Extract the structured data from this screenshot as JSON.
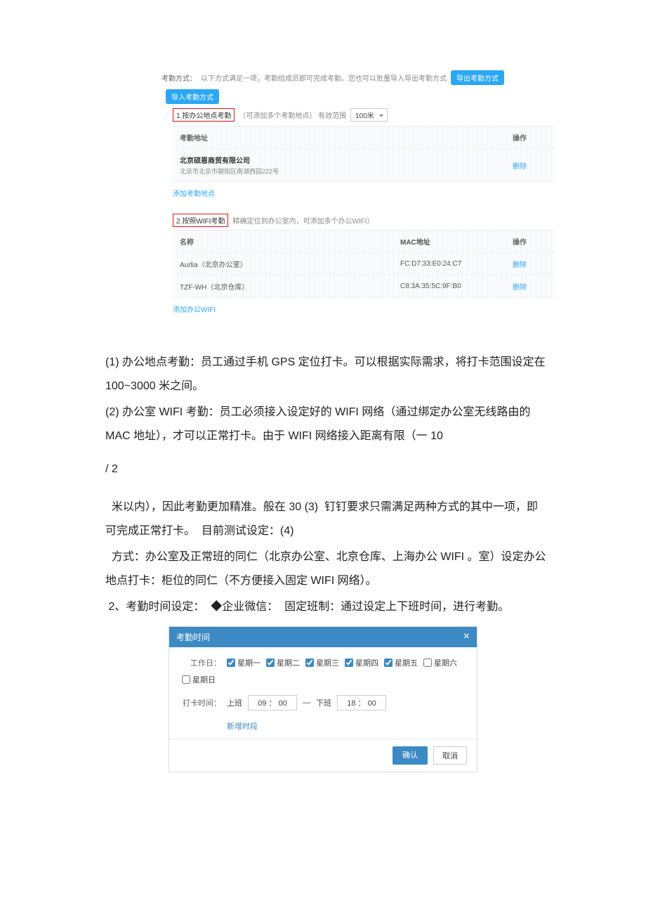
{
  "shot1": {
    "label": "考勤方式：",
    "desc": "以下方式满足一项，考勤组成员即可完成考勤。您也可以批量导入导出考勤方式",
    "btn_export": "导出考勤方式",
    "btn_import": "导入考勤方式",
    "sec1_title": "1.按办公地点考勤",
    "sec1_note": "（可添加多个考勤地点）  有效范围",
    "range_value": "100米",
    "head_addr": "考勤地址",
    "head_op": "操作",
    "company": "北京硕恩商贸有限公司",
    "company_sub": "北京市北京市朝阳区南湖西园222号",
    "row_action": "删除",
    "add_addr": "添加考勤地点",
    "sec2_title": "2.按照WIFI考勤",
    "sec2_note": "精确定位到办公室内，可添加多个办公WIFI）",
    "head_name": "名称",
    "head_mac": "MAC地址",
    "head_op2": "操作",
    "wifi1_name": "Aurlia（北京办公室）",
    "wifi1_mac": "FC:D7:33:E0:24:C7",
    "wifi2_name": "TZF-WH（北京仓库）",
    "wifi2_mac": "C8:3A:35:5C:9F:B0",
    "wifi_action": "删除",
    "add_wifi": "添加办公WIFI"
  },
  "doc": {
    "p1": "(1) 办公地点考勤：员工通过手机 GPS 定位打卡。可以根据实际需求，将打卡范围设定在 100~3000 米之间。",
    "p2": "(2) 办公室 WIFI 考勤：员工必须接入设定好的 WIFI 网络（通过绑定办公室无线路由的 MAC 地址），才可以正常打卡。由于 WIFI 网络接入距离有限（一 10",
    "slash": "/ 2",
    "p3": "  米以内），因此考勤更加精准。般在 30 (3)  钉钉要求只需满足两种方式的其中一项，即可完成正常打卡。  目前测试设定：(4)",
    "p4": "  方式：办公室及正常班的同仁（北京办公室、北京仓库、上海办公 WIFI 。室）设定办公地点打卡：柜位的同仁（不方便接入固定 WIFI 网络）。",
    "p5": " 2、考勤时间设定：  ◆企业微信：  固定班制：通过设定上下班时间，进行考勤。"
  },
  "modal": {
    "title": "考勤时间",
    "close": "×",
    "workday_label": "工作日：",
    "d1": "星期一",
    "d2": "星期二",
    "d3": "星期三",
    "d4": "星期四",
    "d5": "星期五",
    "d6": "星期六",
    "d7": "星期日",
    "time_label": "打卡时间：",
    "on_label": "上班",
    "on_value": "09 ： 00",
    "dash": "—",
    "off_label": "下班",
    "off_value": "18 ： 00",
    "add_slot": "新增时段",
    "ok": "确认",
    "cancel": "取消"
  }
}
